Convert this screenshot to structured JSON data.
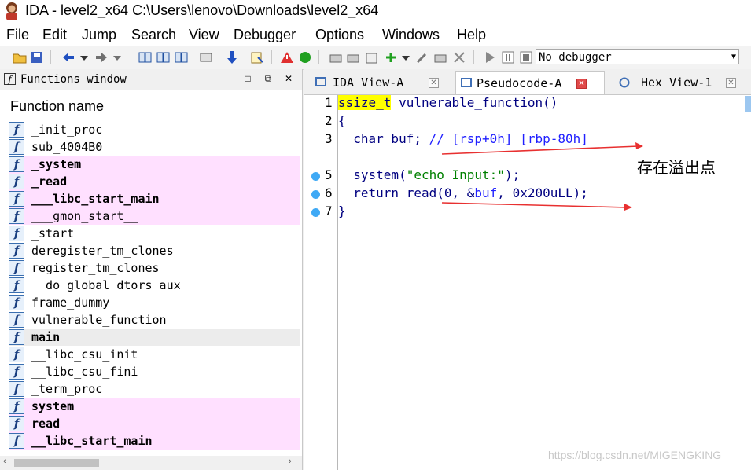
{
  "window": {
    "title": "IDA - level2_x64 C:\\Users\\lenovo\\Downloads\\level2_x64"
  },
  "menu": [
    "File",
    "Edit",
    "Jump",
    "Search",
    "View",
    "Debugger",
    "Options",
    "Windows",
    "Help"
  ],
  "toolbar": {
    "debugger_select": "No debugger",
    "icons": [
      "open-icon",
      "save-icon",
      "back-icon",
      "forward-icon",
      "list-icons",
      "down-arrow-icon",
      "script-icon",
      "warning-icon",
      "run-icon",
      "breakpoint-icon",
      "play-icon",
      "pause-icon",
      "stop-icon"
    ]
  },
  "functions_window": {
    "title": "Functions window",
    "column_header": "Function name",
    "items": [
      {
        "name": "_init_proc",
        "style": "normal"
      },
      {
        "name": "sub_4004B0",
        "style": "normal"
      },
      {
        "name": "_system",
        "style": "import"
      },
      {
        "name": "_read",
        "style": "import"
      },
      {
        "name": "___libc_start_main",
        "style": "import"
      },
      {
        "name": "___gmon_start__",
        "style": "import-thin"
      },
      {
        "name": "_start",
        "style": "normal"
      },
      {
        "name": "deregister_tm_clones",
        "style": "normal"
      },
      {
        "name": "register_tm_clones",
        "style": "normal"
      },
      {
        "name": "__do_global_dtors_aux",
        "style": "normal"
      },
      {
        "name": "frame_dummy",
        "style": "normal"
      },
      {
        "name": "vulnerable_function",
        "style": "normal"
      },
      {
        "name": "main",
        "style": "selected"
      },
      {
        "name": "__libc_csu_init",
        "style": "normal"
      },
      {
        "name": "__libc_csu_fini",
        "style": "normal"
      },
      {
        "name": "_term_proc",
        "style": "normal"
      },
      {
        "name": "system",
        "style": "import"
      },
      {
        "name": "read",
        "style": "import"
      },
      {
        "name": "__libc_start_main",
        "style": "import"
      }
    ]
  },
  "tabs": [
    {
      "label": "IDA View-A",
      "active": false
    },
    {
      "label": "Pseudocode-A",
      "active": true
    },
    {
      "label": "Hex View-1",
      "active": false
    }
  ],
  "code": {
    "lines": [
      {
        "n": "1",
        "bp": false
      },
      {
        "n": "2",
        "bp": false
      },
      {
        "n": "3",
        "bp": false
      },
      {
        "n": "5",
        "bp": true
      },
      {
        "n": "6",
        "bp": true
      },
      {
        "n": "7",
        "bp": true
      }
    ],
    "l1_type": "ssize_t",
    "l1_rest": " vulnerable_function()",
    "l2": "{",
    "l3_code": "  char buf; ",
    "l3_comment": "// [rsp+0h] [rbp-80h]",
    "l5_pre": "  system(",
    "l5_str": "\"echo Input:\"",
    "l5_post": ");",
    "l6_pre": "  return read(0, &",
    "l6_var": "buf",
    "l6_post": ", 0x200uLL);",
    "l7": "}"
  },
  "annotation": "存在溢出点",
  "watermark": "https://blog.csdn.net/MIGENGKING",
  "colors": {
    "import_highlight": "#ffe0ff",
    "arrow": "#e83030",
    "keyword_bg": "#ffff00"
  }
}
